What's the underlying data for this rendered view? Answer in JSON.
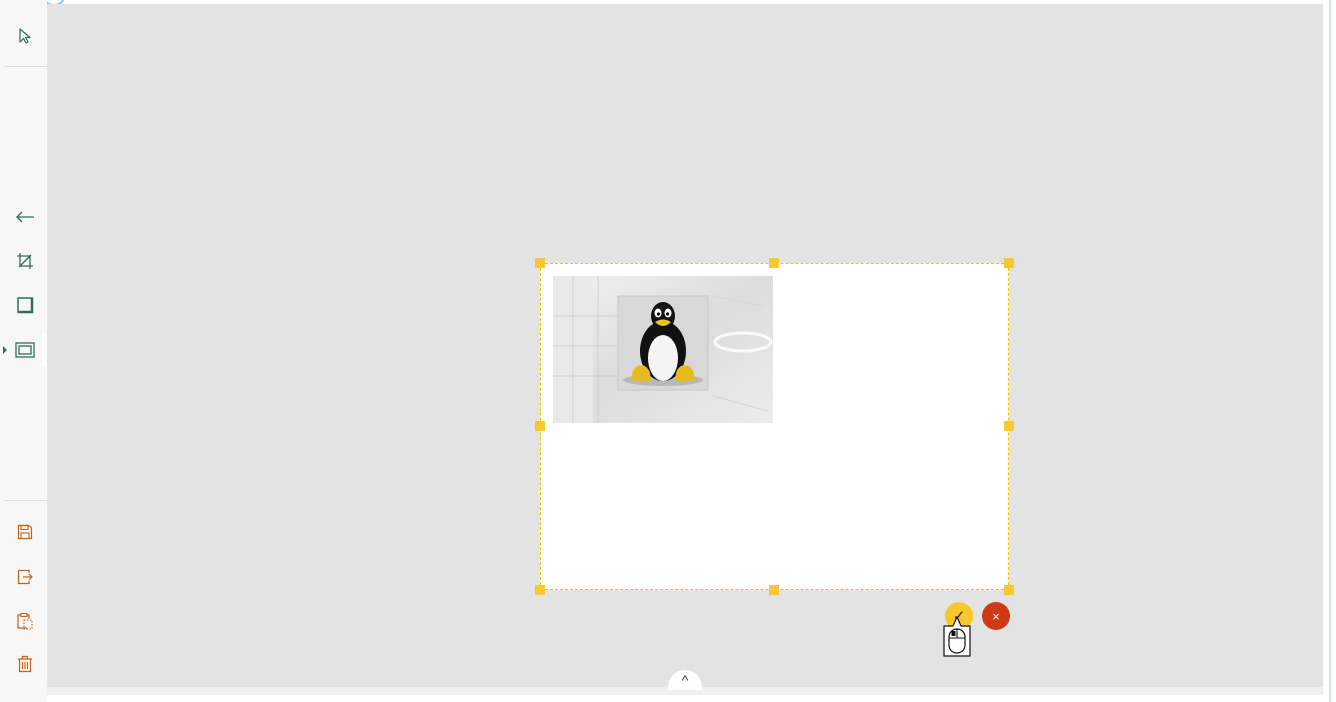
{
  "toolbar": {
    "tools": [
      {
        "name": "select",
        "icon": "pointer-arrow-icon"
      },
      {
        "name": "back",
        "icon": "arrow-left-icon"
      },
      {
        "name": "crop",
        "icon": "crop-icon"
      },
      {
        "name": "shape",
        "icon": "square-icon"
      },
      {
        "name": "frame",
        "icon": "frame-icon",
        "selected": true
      }
    ],
    "file_actions": [
      {
        "name": "save",
        "icon": "floppy-disk-icon"
      },
      {
        "name": "export",
        "icon": "export-icon"
      },
      {
        "name": "paste",
        "icon": "clipboard-icon"
      },
      {
        "name": "delete",
        "icon": "trash-icon"
      }
    ],
    "expand_label": "›"
  },
  "canvas": {
    "photo_subject": "penguin-photo",
    "confirm_label": "✓",
    "cancel_label": "×",
    "collapse_label": "^"
  },
  "colors": {
    "canvas_bg": "#e3e3e3",
    "selection": "#f7c92a",
    "tool_green": "#2f6e5a",
    "tool_orange": "#c0651c",
    "cancel": "#cf3a16",
    "confirm": "#f6c82c"
  }
}
